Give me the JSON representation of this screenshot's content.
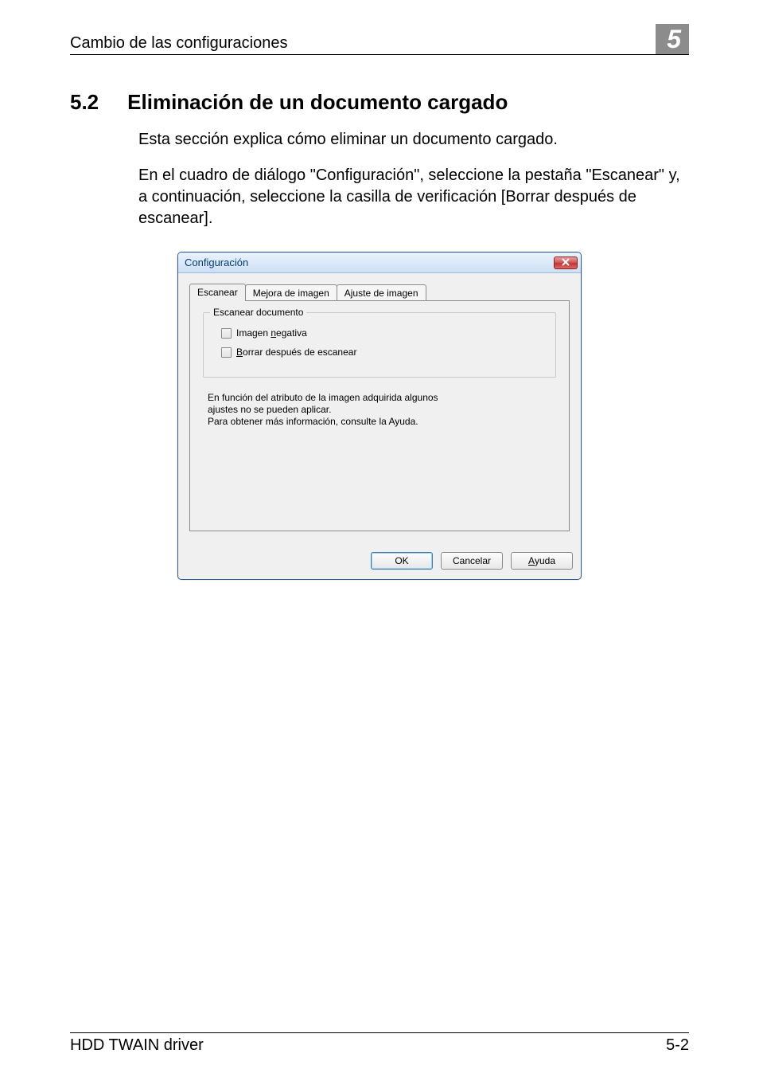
{
  "header": {
    "running_title": "Cambio de las configuraciones",
    "chapter_number": "5"
  },
  "section": {
    "number": "5.2",
    "title": "Eliminación de un documento cargado"
  },
  "paragraph1": "Esta sección explica cómo eliminar un documento cargado.",
  "paragraph2": "En el cuadro de diálogo \"Configuración\", seleccione la pestaña \"Escanear\" y, a continuación, seleccione la casilla de verificación [Borrar después de escanear].",
  "dialog": {
    "title": "Configuración",
    "tabs": [
      {
        "label": "Escanear",
        "active": true
      },
      {
        "label": "Mejora de imagen",
        "active": false
      },
      {
        "label": "Ajuste de imagen",
        "active": false
      }
    ],
    "fieldset_legend": "Escanear documento",
    "checkbox1_html": "Imagen <u>n</u>egativa",
    "checkbox2_html": "<u>B</u>orrar después de escanear",
    "info_line1": "En función del atributo de la imagen adquirida algunos",
    "info_line2": "ajustes no se pueden aplicar.",
    "info_line3": "Para obtener más información, consulte la Ayuda.",
    "buttons": {
      "ok": "OK",
      "cancel": "Cancelar",
      "help_html": "<u>A</u>yuda"
    }
  },
  "footer": {
    "left": "HDD TWAIN driver",
    "right": "5-2"
  }
}
